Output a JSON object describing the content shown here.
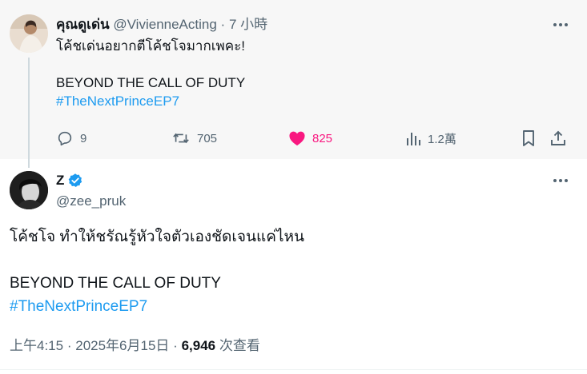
{
  "colors": {
    "accent": "#1d9bf0",
    "like": "#f91880",
    "muted": "#536471",
    "text": "#0f1419",
    "parent_bg": "#f7f7f7"
  },
  "parent_tweet": {
    "display_name": "คุณดูเด่น",
    "handle": "@VivienneActing",
    "separator": "·",
    "time": "7 小時",
    "text_lines": [
      "โค้ชเด่นอยากตีโค้ชโจมากเพคะ!",
      "",
      "BEYOND THE CALL OF DUTY"
    ],
    "hashtag": "#TheNextPrinceEP7",
    "more_icon": "more-horizontal-icon",
    "actions": {
      "replies": "9",
      "reposts": "705",
      "likes": "825",
      "views": "1.2萬"
    }
  },
  "main_tweet": {
    "display_name": "Z",
    "verified": true,
    "handle": "@zee_pruk",
    "text_lines": [
      "โค้ชโจ ทำให้ชรัณรู้หัวใจตัวเองชัดเจนแค่ไหน",
      "",
      "BEYOND THE CALL OF DUTY"
    ],
    "hashtag": "#TheNextPrinceEP7",
    "more_icon": "more-horizontal-icon",
    "meta": {
      "time": "上午4:15",
      "dot1": "·",
      "date": "2025年6月15日",
      "dot2": "·",
      "views": "6,946",
      "views_label": "次查看"
    }
  }
}
